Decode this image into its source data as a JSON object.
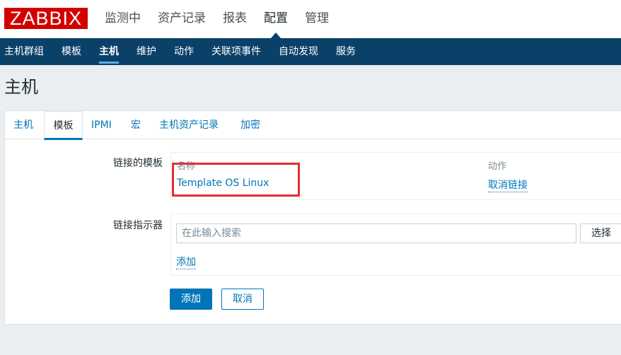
{
  "header": {
    "logo": "ZABBIX",
    "main_menu": [
      {
        "label": "监测中"
      },
      {
        "label": "资产记录"
      },
      {
        "label": "报表"
      },
      {
        "label": "配置",
        "active": true
      },
      {
        "label": "管理"
      }
    ]
  },
  "sub_menu": [
    {
      "label": "主机群组"
    },
    {
      "label": "模板"
    },
    {
      "label": "主机",
      "active": true
    },
    {
      "label": "维护"
    },
    {
      "label": "动作"
    },
    {
      "label": "关联项事件"
    },
    {
      "label": "自动发现"
    },
    {
      "label": "服务"
    }
  ],
  "page_title": "主机",
  "tabs": [
    {
      "label": "主机"
    },
    {
      "label": "模板",
      "active": true
    },
    {
      "label": "IPMI"
    },
    {
      "label": "宏"
    },
    {
      "label": "主机资产记录"
    },
    {
      "label": "加密"
    }
  ],
  "linked_templates": {
    "label": "链接的模板",
    "col_name": "名称",
    "col_action": "动作",
    "rows": [
      {
        "name": "Template OS Linux",
        "action": "取消链接"
      }
    ]
  },
  "link_indicator": {
    "label": "链接指示器",
    "search_placeholder": "在此输入搜索",
    "select_button": "选择",
    "add_link": "添加"
  },
  "form_buttons": {
    "add": "添加",
    "cancel": "取消"
  },
  "colors": {
    "brand": "#d40000",
    "nav_bg": "#0b4168",
    "link": "#0275b8",
    "highlight": "#e42f34"
  }
}
